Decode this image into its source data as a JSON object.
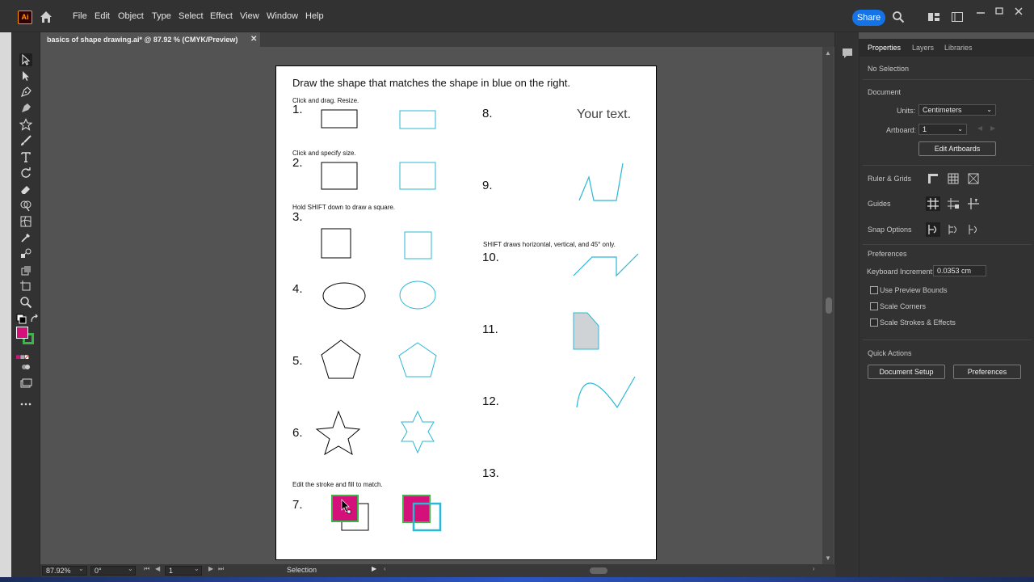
{
  "menubar": {
    "logo": "Ai",
    "items": [
      "File",
      "Edit",
      "Object",
      "Type",
      "Select",
      "Effect",
      "View",
      "Window",
      "Help"
    ],
    "share_label": "Share"
  },
  "document": {
    "tab_title": "basics of shape drawing.ai* @ 87.92 % (CMYK/Preview)",
    "close_glyph": "✕"
  },
  "artboard": {
    "title": "Draw the shape that matches the shape in blue on the right.",
    "notes": {
      "n1": "Click and drag. Resize.",
      "n2": "Click and specify size.",
      "n3": "Hold SHIFT down to draw a square.",
      "n7": "Edit the stroke and fill to match.",
      "n10": "SHIFT draws horizontal, vertical, and 45° only."
    },
    "numbers": [
      "1.",
      "2.",
      "3.",
      "4.",
      "5.",
      "6.",
      "7.",
      "8.",
      "9.",
      "10.",
      "11.",
      "12.",
      "13."
    ],
    "your_text": "Your text.",
    "colors": {
      "blue": "#29b8d6",
      "magenta": "#d4117a",
      "green": "#39b54a",
      "gray_fill": "#cfd3d5"
    }
  },
  "statusbar": {
    "zoom": "87.92%",
    "rotation": "0°",
    "artboard_num": "1",
    "tool": "Selection"
  },
  "panel": {
    "tabs": [
      "Properties",
      "Layers",
      "Libraries"
    ],
    "no_selection": "No Selection",
    "document_label": "Document",
    "units_label": "Units:",
    "units_value": "Centimeters",
    "artboard_label": "Artboard:",
    "artboard_value": "1",
    "edit_artboards": "Edit Artboards",
    "ruler_grids": "Ruler & Grids",
    "guides": "Guides",
    "snap_options": "Snap Options",
    "preferences_label": "Preferences",
    "keyboard_increment_label": "Keyboard Increment:",
    "keyboard_increment_value": "0.0353 cm",
    "use_preview_bounds": "Use Preview Bounds",
    "scale_corners": "Scale Corners",
    "scale_strokes": "Scale Strokes & Effects",
    "quick_actions": "Quick Actions",
    "document_setup": "Document Setup",
    "preferences_button": "Preferences"
  }
}
